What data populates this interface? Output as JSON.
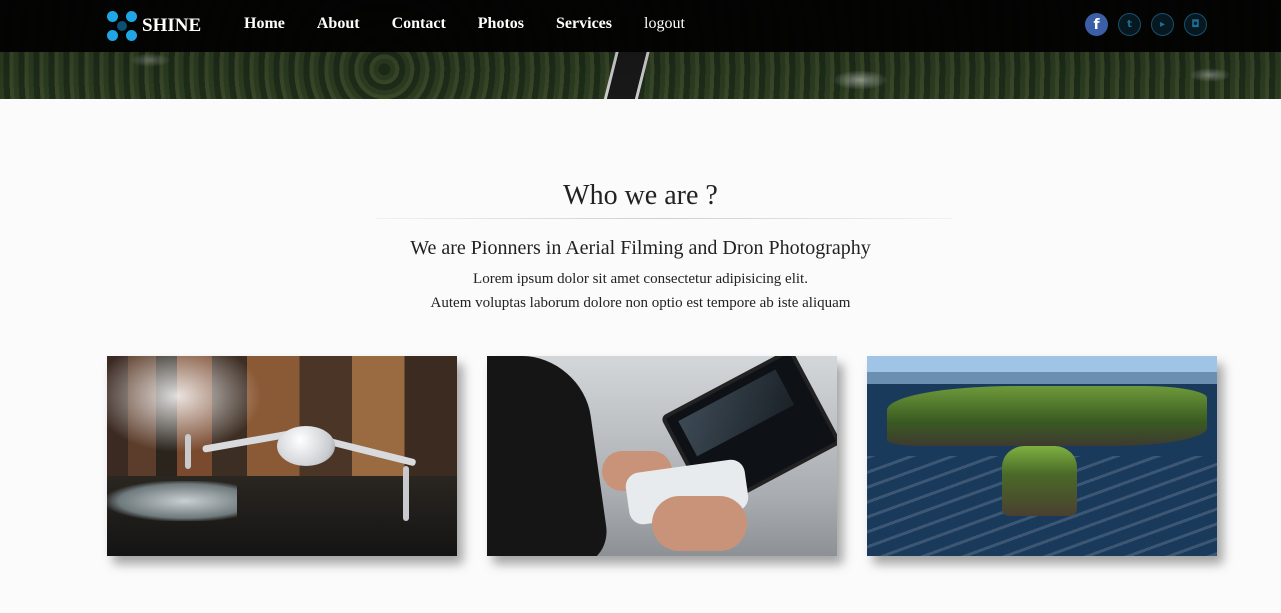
{
  "brand": {
    "name": "SHINE",
    "icon": "drone-dots-logo"
  },
  "nav": {
    "items": [
      {
        "label": "Home"
      },
      {
        "label": "About"
      },
      {
        "label": "Contact"
      },
      {
        "label": "Photos"
      },
      {
        "label": "Services"
      },
      {
        "label": "logout"
      }
    ]
  },
  "social": [
    {
      "icon": "facebook-icon",
      "glyph": "f"
    },
    {
      "icon": "twitter-icon",
      "glyph": "t"
    },
    {
      "icon": "youtube-icon",
      "glyph": "▸"
    },
    {
      "icon": "instagram-icon",
      "glyph": "◘"
    }
  ],
  "about": {
    "title": "Who we are ?",
    "subtitle": "We are Pionners in Aerial Filming and Dron Photography",
    "line1": "Lorem ipsum dolor sit amet consectetur adipisicing elit.",
    "line2": "Autem voluptas laborum dolore non optio est tempore ab iste aliquam"
  },
  "cards": [
    {
      "subject": "drone flying over forest river"
    },
    {
      "subject": "hands holding drone remote controller with tablet"
    },
    {
      "subject": "aerial view of coastal cliffs and sea stack"
    }
  ],
  "colors": {
    "navbar": "#020202",
    "accent": "#1ea7e4",
    "facebook": "#3b5fa6"
  }
}
